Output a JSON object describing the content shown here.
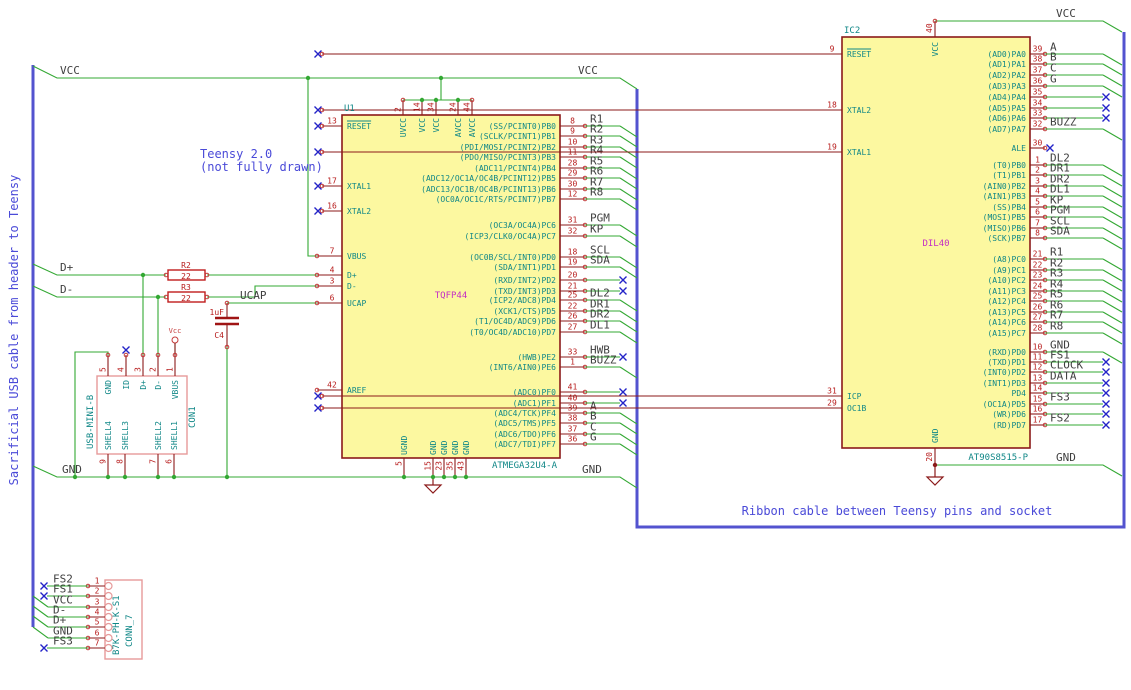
{
  "notes": {
    "left_cable": "Sacrificial USB cable from header to Teensy",
    "teensy_1": "Teensy 2.0",
    "teensy_2": "(not fully drawn)",
    "ribbon": "Ribbon cable between Teensy pins and socket"
  },
  "power_nets": {
    "vcc": "VCC",
    "gnd": "GND",
    "ucap": "UCAP",
    "dplus": "D+",
    "dminus": "D-"
  },
  "colors": {
    "wire": "#33a833",
    "bus": "#5353cf",
    "component_outline": "#8b1a1a",
    "component_fill": "#fcf8a0",
    "pin_name": "#108787",
    "pin_number": "#b71b1b",
    "net_label": "#3f3f3f",
    "note_text": "#4a4ad8",
    "no_connect": "#2424c8",
    "connector_outline": "#e69a9a",
    "field": "#c42ec4"
  },
  "u1": {
    "ref": "U1",
    "footprint": "TQFP44",
    "part": "ATMEGA32U4-A",
    "left_pins": [
      {
        "num": "13",
        "name": "RESET",
        "overline": true,
        "nc": true
      },
      {
        "num": "17",
        "name": "XTAL1",
        "nc": true
      },
      {
        "num": "16",
        "name": "XTAL2",
        "nc": true
      },
      {
        "num": "7",
        "name": "VBUS"
      },
      {
        "num": "4",
        "name": "D+"
      },
      {
        "num": "3",
        "name": "D-"
      },
      {
        "num": "6",
        "name": "UCAP"
      },
      {
        "num": "42",
        "name": "AREF"
      }
    ],
    "top_pins": [
      {
        "num": "2",
        "name": "UVCC"
      },
      {
        "num": "14",
        "name": "VCC"
      },
      {
        "num": "34",
        "name": "VCC"
      },
      {
        "num": "24",
        "name": "AVCC"
      },
      {
        "num": "44",
        "name": "AVCC"
      }
    ],
    "bottom_pins": [
      {
        "num": "5",
        "name": "UGND"
      },
      {
        "num": "15",
        "name": "GND"
      },
      {
        "num": "23",
        "name": "GND"
      },
      {
        "num": "35",
        "name": "GND"
      },
      {
        "num": "43",
        "name": "GND"
      }
    ],
    "right_pins": [
      {
        "num": "8",
        "name": "(SS/PCINT0)PB0",
        "net": "R1"
      },
      {
        "num": "9",
        "name": "(SCLK/PCINT1)PB1",
        "net": "R2"
      },
      {
        "num": "10",
        "name": "(PDI/MOSI/PCINT2)PB2",
        "net": "R3"
      },
      {
        "num": "11",
        "name": "(PDO/MISO/PCINT3)PB3",
        "net": "R4"
      },
      {
        "num": "28",
        "name": "(ADC11/PCINT4)PB4",
        "net": "R5"
      },
      {
        "num": "29",
        "name": "(ADC12/OC1A/OC4B/PCINT12)PB5",
        "net": "R6"
      },
      {
        "num": "30",
        "name": "(ADC13/OC1B/OC4B/PCINT13)PB6",
        "net": "R7"
      },
      {
        "num": "12",
        "name": "(OC0A/OC1C/RTS/PCINT7)PB7",
        "net": "R8"
      },
      {
        "num": "31",
        "name": "(OC3A/OC4A)PC6",
        "net": "PGM"
      },
      {
        "num": "32",
        "name": "(ICP3/CLK0/OC4A)PC7",
        "net": "KP"
      },
      {
        "num": "18",
        "name": "(OC0B/SCL/INT0)PD0",
        "net": "SCL"
      },
      {
        "num": "19",
        "name": "(SDA/INT1)PD1",
        "net": "SDA"
      },
      {
        "num": "20",
        "name": "(RXD/INT2)PD2",
        "net": "",
        "nc": true
      },
      {
        "num": "21",
        "name": "(TXD/INT3)PD3",
        "net": "",
        "nc": true
      },
      {
        "num": "25",
        "name": "(ICP2/ADC8)PD4",
        "net": "DL2"
      },
      {
        "num": "22",
        "name": "(XCK1/CTS)PD5",
        "net": "DR1"
      },
      {
        "num": "26",
        "name": "(T1/OC4D/ADC9)PD6",
        "net": "DR2"
      },
      {
        "num": "27",
        "name": "(T0/OC4D/ADC10)PD7",
        "net": "DL1"
      },
      {
        "num": "33",
        "name": "(HWB)PE2",
        "net": "HWB",
        "nc": true
      },
      {
        "num": "1",
        "name": "(INT6/AIN0)PE6",
        "net": "BUZZ"
      },
      {
        "num": "41",
        "name": "(ADC0)PF0",
        "net": "",
        "nc": true
      },
      {
        "num": "40",
        "name": "(ADC1)PF1",
        "net": "",
        "nc": true
      },
      {
        "num": "39",
        "name": "(ADC4/TCK)PF4",
        "net": "A"
      },
      {
        "num": "38",
        "name": "(ADC5/TMS)PF5",
        "net": "B"
      },
      {
        "num": "37",
        "name": "(ADC6/TDO)PF6",
        "net": "C"
      },
      {
        "num": "36",
        "name": "(ADC7/TDI)PF7",
        "net": "G"
      }
    ]
  },
  "ic2": {
    "ref": "IC2",
    "footprint": "DIL40",
    "part": "AT90S8515-P",
    "top_pin": {
      "num": "40",
      "name": "VCC"
    },
    "bottom_pin": {
      "num": "20",
      "name": "GND"
    },
    "left_pins": [
      {
        "num": "9",
        "name": "RESET",
        "overline": true,
        "nc": true
      },
      {
        "num": "18",
        "name": "XTAL2",
        "nc": true
      },
      {
        "num": "19",
        "name": "XTAL1",
        "nc": true
      },
      {
        "num": "31",
        "name": "ICP",
        "nc": true
      },
      {
        "num": "29",
        "name": "OC1B",
        "nc": true
      }
    ],
    "right_pins": [
      {
        "num": "39",
        "name": "(AD0)PA0",
        "net": "A"
      },
      {
        "num": "38",
        "name": "(AD1)PA1",
        "net": "B"
      },
      {
        "num": "37",
        "name": "(AD2)PA2",
        "net": "C"
      },
      {
        "num": "36",
        "name": "(AD3)PA3",
        "net": "G"
      },
      {
        "num": "35",
        "name": "(AD4)PA4",
        "net": "",
        "nc": true
      },
      {
        "num": "34",
        "name": "(AD5)PA5",
        "net": "",
        "nc": true
      },
      {
        "num": "33",
        "name": "(AD6)PA6",
        "net": "",
        "nc": true
      },
      {
        "num": "32",
        "name": "(AD7)PA7",
        "net": "BUZZ"
      },
      {
        "num": "30",
        "name": "ALE",
        "net": "",
        "nc_at_pin": true
      },
      {
        "num": "1",
        "name": "(T0)PB0",
        "net": "DL2"
      },
      {
        "num": "2",
        "name": "(T1)PB1",
        "net": "DR1"
      },
      {
        "num": "3",
        "name": "(AIN0)PB2",
        "net": "DR2"
      },
      {
        "num": "4",
        "name": "(AIN1)PB3",
        "net": "DL1"
      },
      {
        "num": "5",
        "name": "(SS)PB4",
        "net": "KP"
      },
      {
        "num": "6",
        "name": "(MOSI)PB5",
        "net": "PGM"
      },
      {
        "num": "7",
        "name": "(MISO)PB6",
        "net": "SCL"
      },
      {
        "num": "8",
        "name": "(SCK)PB7",
        "net": "SDA"
      },
      {
        "num": "21",
        "name": "(A8)PC0",
        "net": "R1"
      },
      {
        "num": "22",
        "name": "(A9)PC1",
        "net": "R2"
      },
      {
        "num": "23",
        "name": "(A10)PC2",
        "net": "R3"
      },
      {
        "num": "24",
        "name": "(A11)PC3",
        "net": "R4"
      },
      {
        "num": "25",
        "name": "(A12)PC4",
        "net": "R5"
      },
      {
        "num": "26",
        "name": "(A13)PC5",
        "net": "R6"
      },
      {
        "num": "27",
        "name": "(A14)PC6",
        "net": "R7"
      },
      {
        "num": "28",
        "name": "(A15)PC7",
        "net": "R8"
      },
      {
        "num": "10",
        "name": "(RXD)PD0",
        "net": "GND"
      },
      {
        "num": "11",
        "name": "(TXD)PD1",
        "net": "FS1",
        "nc": true
      },
      {
        "num": "12",
        "name": "(INT0)PD2",
        "net": "CLOCK",
        "nc": true
      },
      {
        "num": "13",
        "name": "(INT1)PD3",
        "net": "DATA",
        "nc": true
      },
      {
        "num": "14",
        "name": "PD4",
        "net": "",
        "nc": true
      },
      {
        "num": "15",
        "name": "(OC1A)PD5",
        "net": "FS3",
        "nc": true
      },
      {
        "num": "16",
        "name": "(WR)PD6",
        "net": "",
        "nc": true
      },
      {
        "num": "17",
        "name": "(RD)PD7",
        "net": "FS2",
        "nc": true
      }
    ]
  },
  "usb_conn": {
    "ref": "CON1",
    "value": "USB-MINI-B",
    "vcc_symbol": "Vcc",
    "top_pins": [
      {
        "num": "5",
        "name": "GND"
      },
      {
        "num": "4",
        "name": "ID",
        "nc": true
      },
      {
        "num": "3",
        "name": "D+"
      },
      {
        "num": "2",
        "name": "D-"
      },
      {
        "num": "1",
        "name": "VBUS"
      }
    ],
    "bottom_pins": [
      {
        "num": "9",
        "name": "SHELL4"
      },
      {
        "num": "8",
        "name": "SHELL3"
      },
      {
        "num": "7",
        "name": "SHELL2"
      },
      {
        "num": "6",
        "name": "SHELL1"
      }
    ]
  },
  "conn7": {
    "ref": "CONN_7",
    "value": "B7K-PH-K-S1",
    "pins": [
      {
        "num": "1",
        "net": "FS2",
        "nc": true
      },
      {
        "num": "2",
        "net": "FS1",
        "nc": true
      },
      {
        "num": "3",
        "net": "VCC"
      },
      {
        "num": "4",
        "net": "D-"
      },
      {
        "num": "5",
        "net": "D+"
      },
      {
        "num": "6",
        "net": "GND"
      },
      {
        "num": "7",
        "net": "FS3",
        "nc": true
      }
    ]
  },
  "resistors": [
    {
      "ref": "R2",
      "value": "22"
    },
    {
      "ref": "R3",
      "value": "22"
    }
  ],
  "capacitor": {
    "ref": "C4",
    "value": "1uF"
  }
}
